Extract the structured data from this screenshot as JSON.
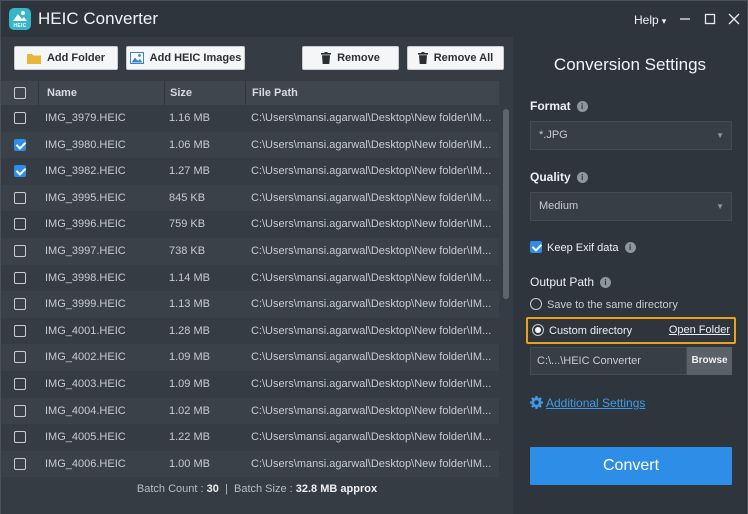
{
  "app": {
    "title": "HEIC Converter",
    "logo_text": "HEIC",
    "menu_help": "Help"
  },
  "toolbar": {
    "add_folder": "Add Folder",
    "add_heic_images": "Add HEIC Images",
    "remove": "Remove",
    "remove_all": "Remove All"
  },
  "table": {
    "headers": [
      "Name",
      "Size",
      "File Path"
    ],
    "rows": [
      {
        "name": "IMG_3979.HEIC",
        "size": "1.16 MB",
        "path": "C:\\Users\\mansi.agarwal\\Desktop\\New folder\\IM...",
        "checked": false
      },
      {
        "name": "IMG_3980.HEIC",
        "size": "1.06 MB",
        "path": "C:\\Users\\mansi.agarwal\\Desktop\\New folder\\IM...",
        "checked": true
      },
      {
        "name": "IMG_3982.HEIC",
        "size": "1.27 MB",
        "path": "C:\\Users\\mansi.agarwal\\Desktop\\New folder\\IM...",
        "checked": true
      },
      {
        "name": "IMG_3995.HEIC",
        "size": "845 KB",
        "path": "C:\\Users\\mansi.agarwal\\Desktop\\New folder\\IM...",
        "checked": false
      },
      {
        "name": "IMG_3996.HEIC",
        "size": "759 KB",
        "path": "C:\\Users\\mansi.agarwal\\Desktop\\New folder\\IM...",
        "checked": false
      },
      {
        "name": "IMG_3997.HEIC",
        "size": "738 KB",
        "path": "C:\\Users\\mansi.agarwal\\Desktop\\New folder\\IM...",
        "checked": false
      },
      {
        "name": "IMG_3998.HEIC",
        "size": "1.14 MB",
        "path": "C:\\Users\\mansi.agarwal\\Desktop\\New folder\\IM...",
        "checked": false
      },
      {
        "name": "IMG_3999.HEIC",
        "size": "1.13 MB",
        "path": "C:\\Users\\mansi.agarwal\\Desktop\\New folder\\IM...",
        "checked": false
      },
      {
        "name": "IMG_4001.HEIC",
        "size": "1.28 MB",
        "path": "C:\\Users\\mansi.agarwal\\Desktop\\New folder\\IM...",
        "checked": false
      },
      {
        "name": "IMG_4002.HEIC",
        "size": "1.09 MB",
        "path": "C:\\Users\\mansi.agarwal\\Desktop\\New folder\\IM...",
        "checked": false
      },
      {
        "name": "IMG_4003.HEIC",
        "size": "1.09 MB",
        "path": "C:\\Users\\mansi.agarwal\\Desktop\\New folder\\IM...",
        "checked": false
      },
      {
        "name": "IMG_4004.HEIC",
        "size": "1.02 MB",
        "path": "C:\\Users\\mansi.agarwal\\Desktop\\New folder\\IM...",
        "checked": false
      },
      {
        "name": "IMG_4005.HEIC",
        "size": "1.22 MB",
        "path": "C:\\Users\\mansi.agarwal\\Desktop\\New folder\\IM...",
        "checked": false
      },
      {
        "name": "IMG_4006.HEIC",
        "size": "1.00 MB",
        "path": "C:\\Users\\mansi.agarwal\\Desktop\\New folder\\IM...",
        "checked": false
      }
    ]
  },
  "footer": {
    "batch_count_label": "Batch Count :",
    "batch_count_value": "30",
    "separator": "|",
    "batch_size_label": "Batch Size :",
    "batch_size_value": "32.8 MB approx"
  },
  "settings": {
    "title": "Conversion Settings",
    "format_label": "Format",
    "format_value": "*.JPG",
    "quality_label": "Quality",
    "quality_value": "Medium",
    "keep_exif_label": "Keep Exif data",
    "keep_exif_checked": true,
    "output_path_label": "Output Path",
    "radio_same_dir": "Save to the same directory",
    "radio_custom_dir": "Custom directory",
    "open_folder": "Open Folder",
    "path_value": "C:\\...\\HEIC Converter",
    "browse": "Browse",
    "additional_settings": "Additional Settings",
    "convert": "Convert",
    "info_glyph": "i"
  },
  "colors": {
    "accent": "#2e8de6",
    "highlight_border": "#e8a21b",
    "logo": "#35b6c9"
  }
}
